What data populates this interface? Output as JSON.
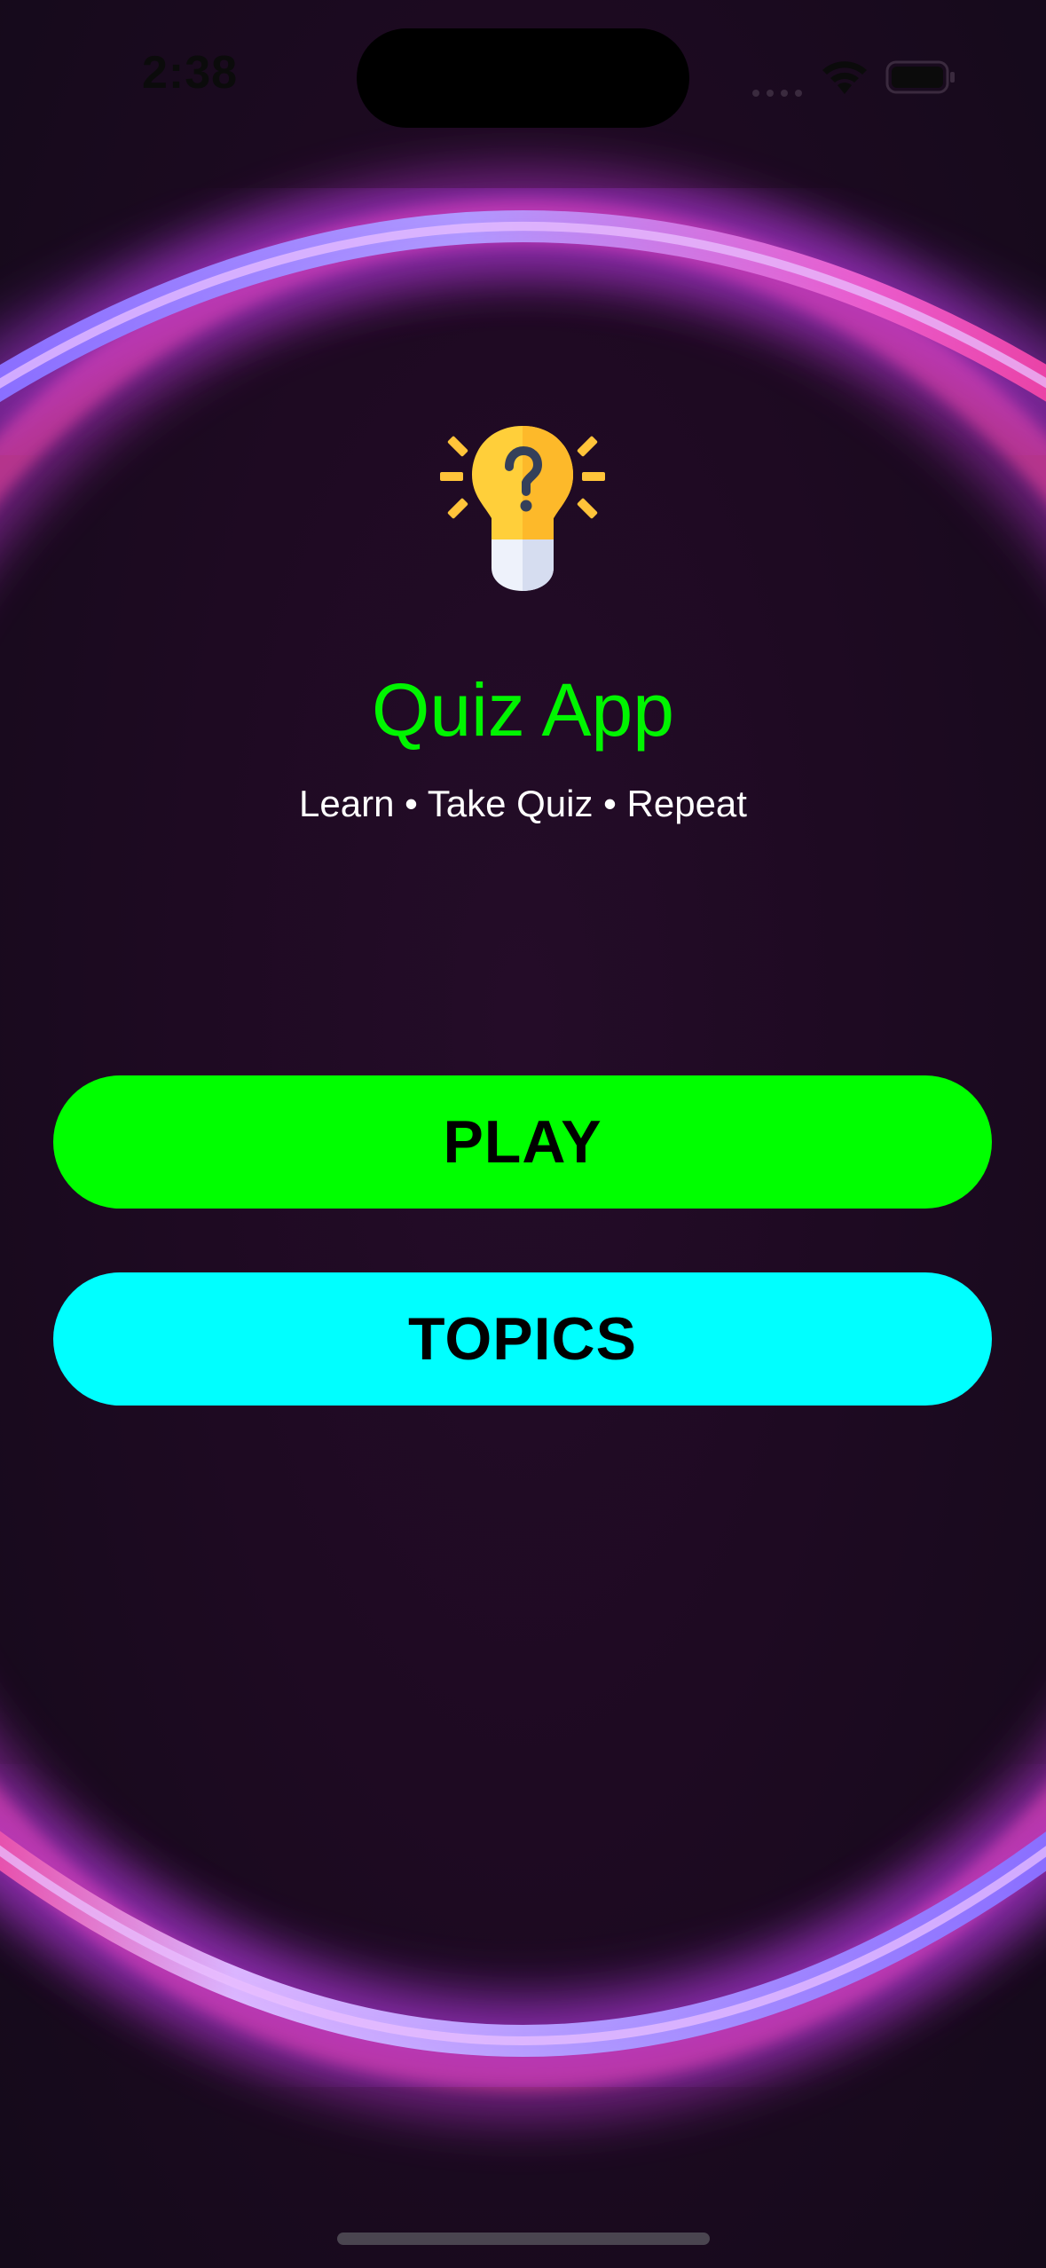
{
  "status_bar": {
    "time": "2:38"
  },
  "app": {
    "title": "Quiz App",
    "subtitle": "Learn • Take Quiz • Repeat",
    "logo_icon": "lightbulb-question-icon"
  },
  "buttons": {
    "play_label": "PLAY",
    "topics_label": "TOPICS"
  },
  "colors": {
    "title": "#00f500",
    "play_button": "#00ff00",
    "topics_button": "#00ffff",
    "background": "#1e0a22"
  }
}
